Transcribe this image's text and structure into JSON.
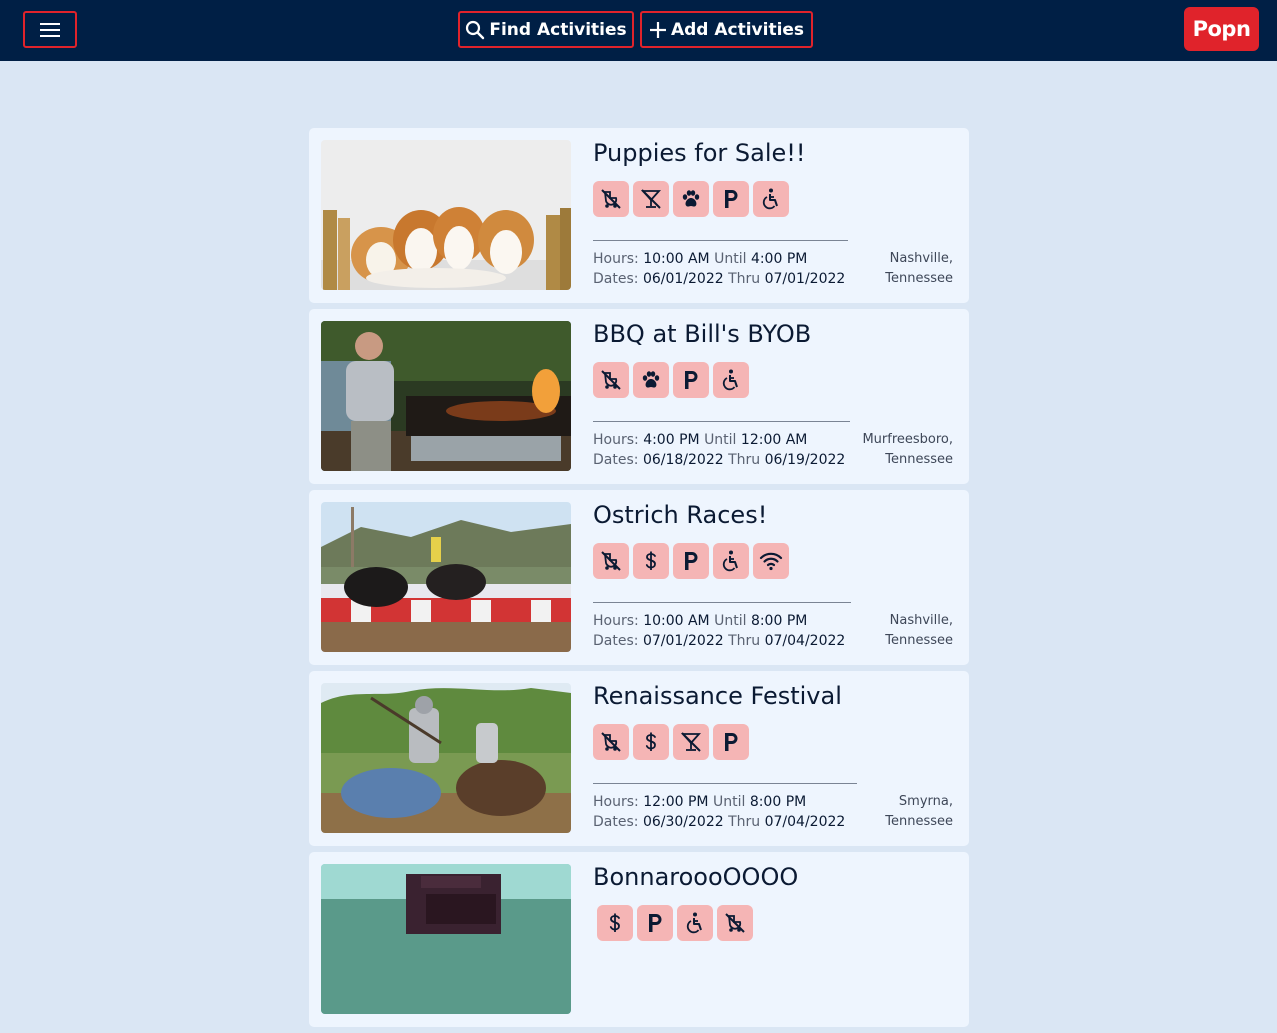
{
  "header": {
    "find_label": "Find Activities",
    "add_label": "Add Activities",
    "brand": "Popn"
  },
  "labels": {
    "hours": "Hours:",
    "until": "Until",
    "dates": "Dates:",
    "thru": "Thru"
  },
  "colors": {
    "topbar": "#001f45",
    "accent": "#e0232b",
    "tag_bg": "#f5b5b5",
    "page_bg": "#dae6f4",
    "card_bg": "#eef5fe"
  },
  "activities": [
    {
      "title": "Puppies for Sale!!",
      "tags": [
        "no-stroller-icon",
        "no-alcohol-icon",
        "pet-paw-icon",
        "parking-icon",
        "wheelchair-icon"
      ],
      "hours_from": "10:00 AM",
      "hours_until": "4:00 PM",
      "date_from": "06/01/2022",
      "date_thru": "07/01/2022",
      "city": "Nashville,",
      "state": "Tennessee"
    },
    {
      "title": "BBQ at Bill's BYOB",
      "tags": [
        "no-stroller-icon",
        "pet-paw-icon",
        "parking-icon",
        "wheelchair-icon"
      ],
      "hours_from": "4:00 PM",
      "hours_until": "12:00 AM",
      "date_from": "06/18/2022",
      "date_thru": "06/19/2022",
      "city": "Murfreesboro,",
      "state": "Tennessee"
    },
    {
      "title": "Ostrich Races!",
      "tags": [
        "no-stroller-icon",
        "dollar-icon",
        "parking-icon",
        "wheelchair-icon",
        "wifi-icon"
      ],
      "hours_from": "10:00 AM",
      "hours_until": "8:00 PM",
      "date_from": "07/01/2022",
      "date_thru": "07/04/2022",
      "city": "Nashville,",
      "state": "Tennessee"
    },
    {
      "title": "Renaissance Festival",
      "tags": [
        "no-stroller-icon",
        "dollar-icon",
        "no-alcohol-icon",
        "parking-icon"
      ],
      "hours_from": "12:00 PM",
      "hours_until": "8:00 PM",
      "date_from": "06/30/2022",
      "date_thru": "07/04/2022",
      "city": "Smyrna,",
      "state": "Tennessee"
    },
    {
      "title": "BonnaroooOOOO",
      "tags": [
        "dollar-icon",
        "parking-icon",
        "wheelchair-icon",
        "no-stroller-icon"
      ],
      "hours_from": "",
      "hours_until": "",
      "date_from": "",
      "date_thru": "",
      "city": "",
      "state": ""
    }
  ]
}
